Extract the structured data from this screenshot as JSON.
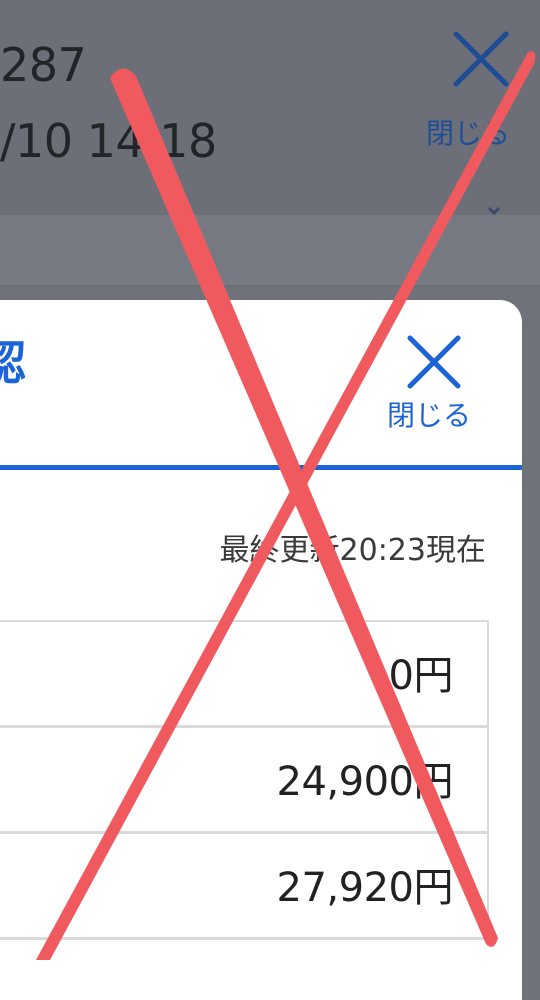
{
  "background": {
    "line1": "287",
    "line2": "/10 14:18",
    "close_label": "閉じる"
  },
  "modal": {
    "title": "認",
    "close_label": "閉じる",
    "updated": "最終更新20:23現在",
    "rows": [
      {
        "value": "0円"
      },
      {
        "value": "24,900円"
      },
      {
        "value": "27,920円"
      }
    ]
  },
  "colors": {
    "accent": "#1a64d8",
    "overlay_cross": "#f05a5f",
    "dim_background": "#6f7279"
  }
}
